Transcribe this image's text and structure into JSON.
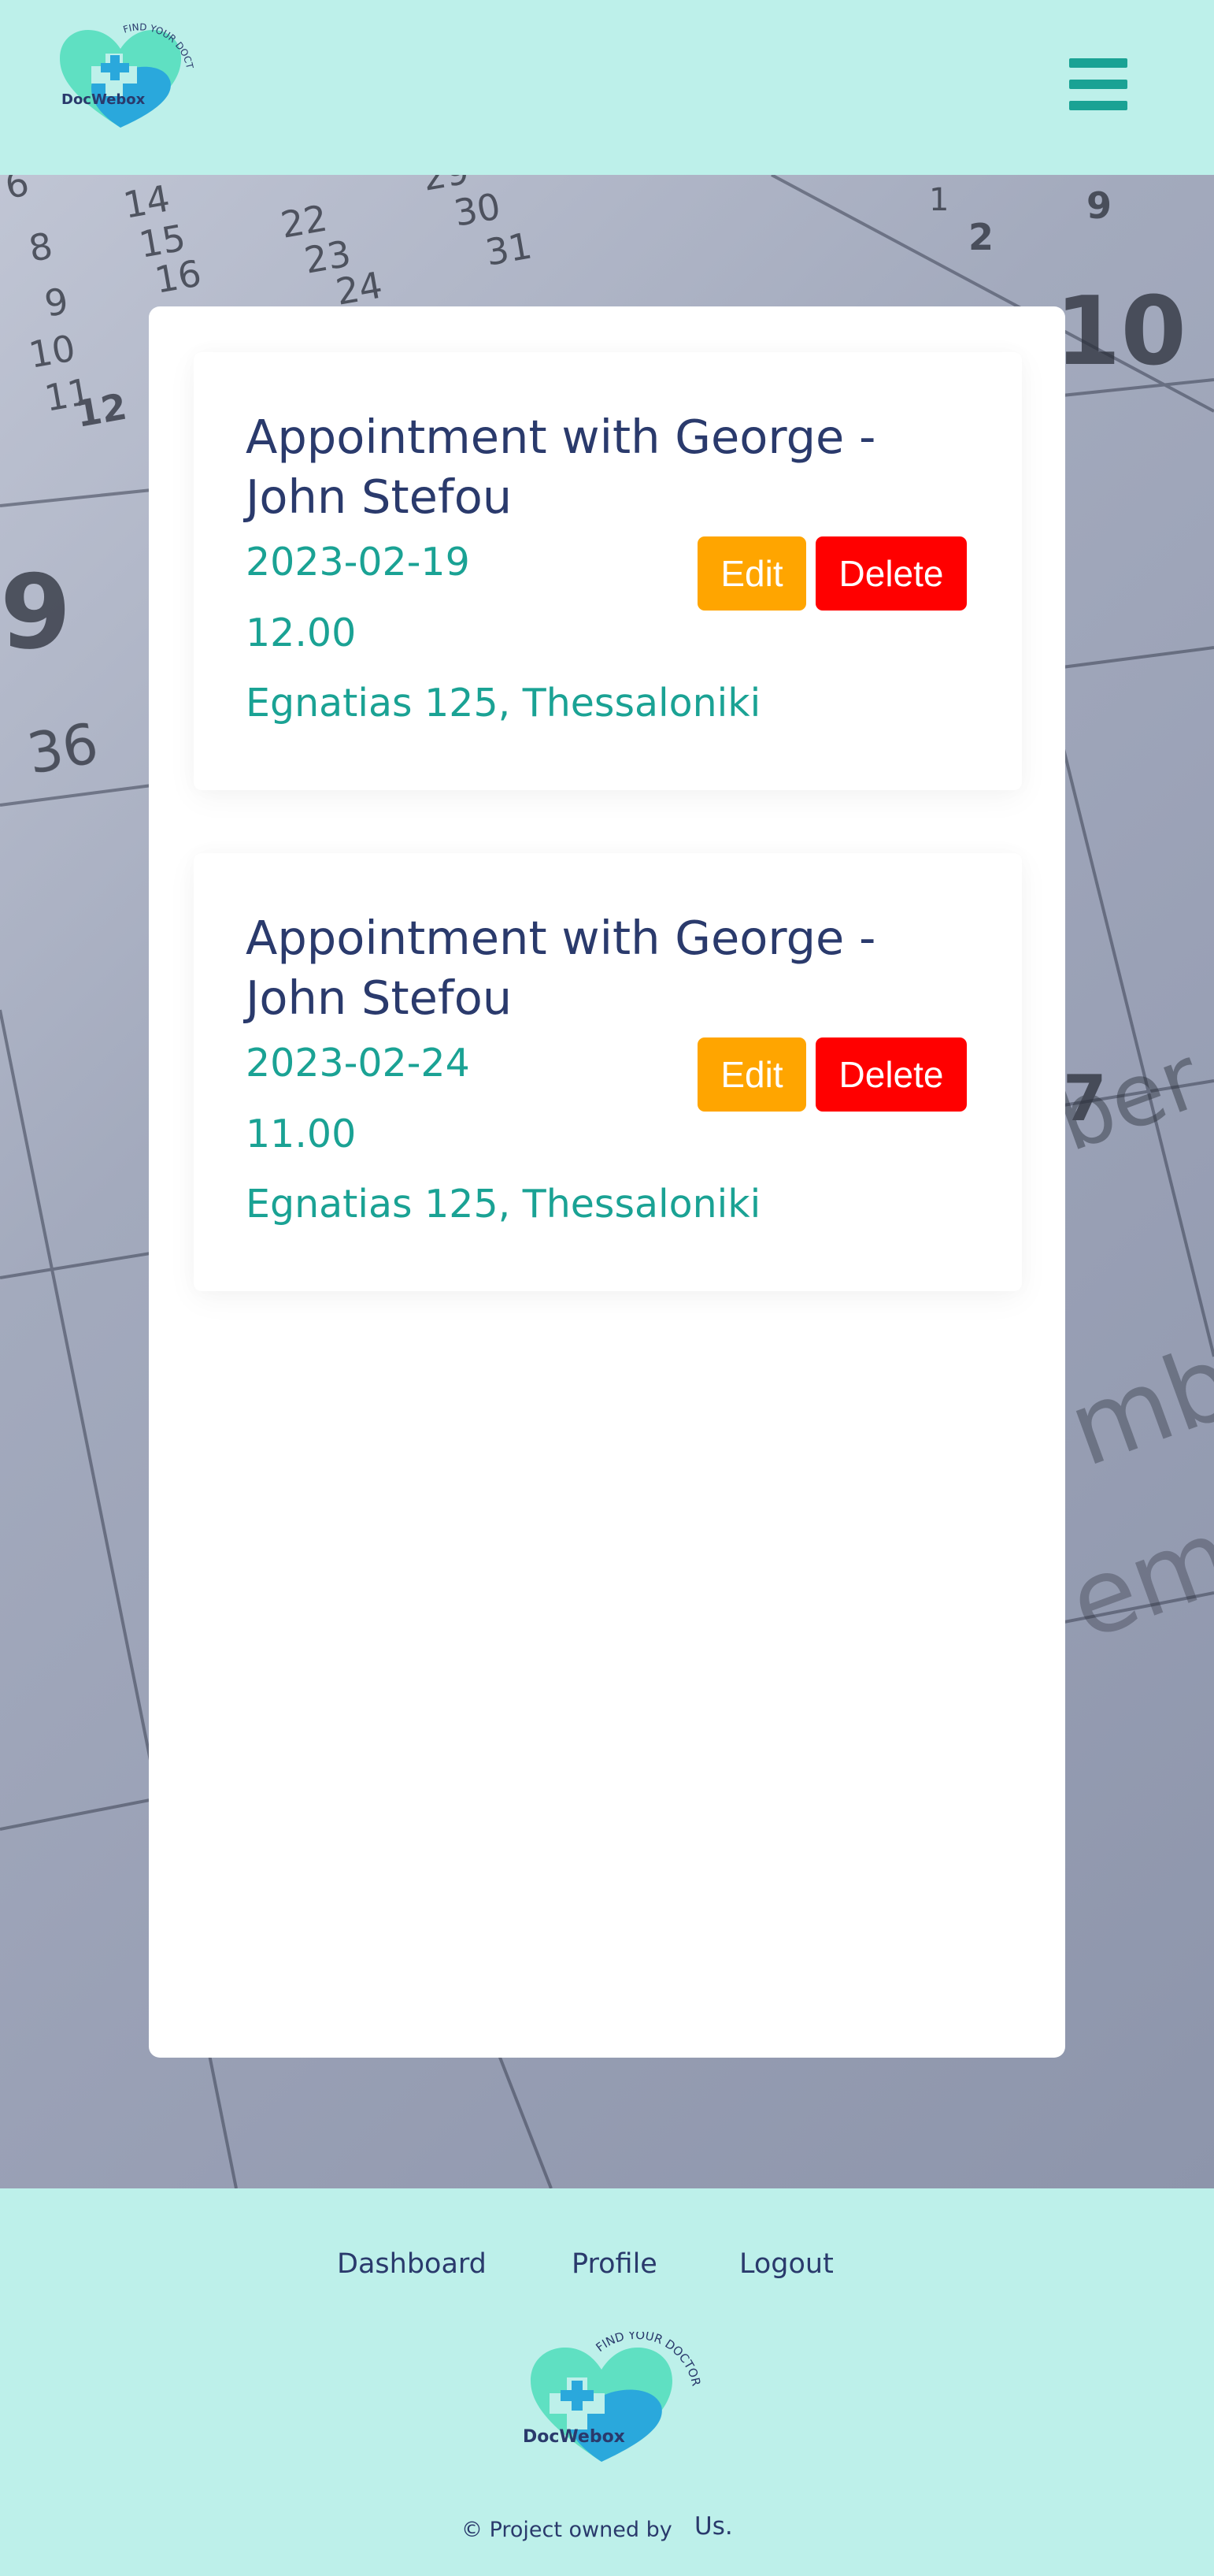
{
  "header": {
    "logo_brand": "DocWebox",
    "logo_tagline": "FIND YOUR DOCTOR",
    "menu_icon": "hamburger-menu-icon"
  },
  "appointments": [
    {
      "title": "Appointment with George - John Stefou",
      "date": "2023-02-19",
      "time": "12.00",
      "address": "Egnatias 125, Thessaloniki",
      "edit_label": "Edit",
      "delete_label": "Delete"
    },
    {
      "title": "Appointment with George - John Stefou",
      "date": "2023-02-24",
      "time": "11.00",
      "address": "Egnatias 125, Thessaloniki",
      "edit_label": "Edit",
      "delete_label": "Delete"
    }
  ],
  "footer": {
    "nav": [
      "Dashboard",
      "Profile",
      "Logout"
    ],
    "logo_brand": "DocWebox",
    "logo_tagline": "FIND YOUR DOCTOR",
    "copyright": "© Project owned by",
    "owner_link": "Us."
  },
  "colors": {
    "mint_background": "#bdf0ea",
    "teal_accent": "#1aa294",
    "navy_text": "#2a3a6c",
    "edit_button": "#ffa500",
    "delete_button": "#ff0000"
  }
}
